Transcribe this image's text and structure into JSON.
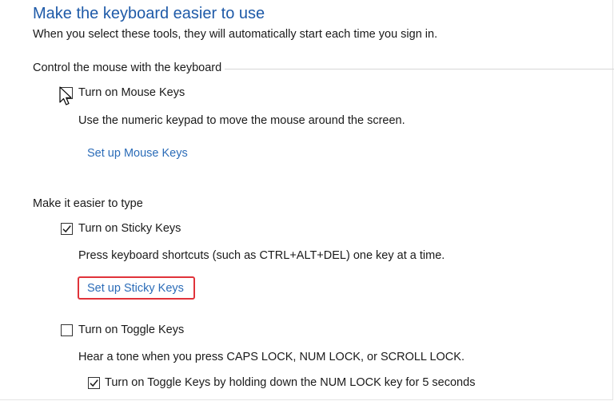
{
  "header": {
    "title": "Make the keyboard easier to use",
    "subtitle": "When you select these tools, they will automatically start each time you sign in."
  },
  "mouse_group": {
    "heading": "Control the mouse with the keyboard",
    "mouse_keys": {
      "label": "Turn on Mouse Keys",
      "checked": false,
      "description": "Use the numeric keypad to move the mouse around the screen.",
      "setup_link": "Set up Mouse Keys"
    }
  },
  "typing_group": {
    "heading": "Make it easier to type",
    "sticky_keys": {
      "label": "Turn on Sticky Keys",
      "checked": true,
      "description": "Press keyboard shortcuts (such as CTRL+ALT+DEL) one key at a time.",
      "setup_link": "Set up Sticky Keys"
    },
    "toggle_keys": {
      "label": "Turn on Toggle Keys",
      "checked": false,
      "description": "Hear a tone when you press CAPS LOCK, NUM LOCK, or SCROLL LOCK.",
      "hold_option": {
        "label": "Turn on Toggle Keys by holding down the NUM LOCK key for 5 seconds",
        "checked": true
      }
    }
  },
  "colors": {
    "title": "#1e5aa8",
    "link": "#2b6cb8",
    "highlight": "#e0333a"
  },
  "icons": {
    "checkmark": "checkmark-icon",
    "cursor": "mouse-pointer-icon"
  }
}
